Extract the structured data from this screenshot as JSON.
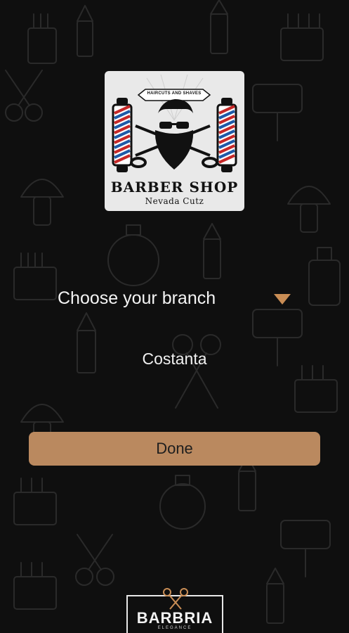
{
  "logo": {
    "ribbon_text": "HAIRCUTS AND SHAVES",
    "shop_name": "BARBER SHOP",
    "shop_subtitle": "Nevada Cutz"
  },
  "branch": {
    "label": "Choose your branch",
    "selected": "Costanta"
  },
  "actions": {
    "done_label": "Done"
  },
  "brand": {
    "name": "BARBRIA",
    "tagline": "ELEGANCE"
  },
  "colors": {
    "background": "#0f0f0f",
    "accent": "#c98d55",
    "button": "#ba895f"
  },
  "icons": [
    "dropdown-caret-icon",
    "barber-pole-icon",
    "scissors-icon",
    "razor-icon",
    "lipstick-icon",
    "comb-icon"
  ]
}
